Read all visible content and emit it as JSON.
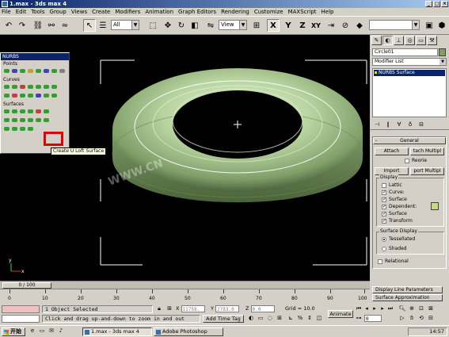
{
  "window": {
    "title": "1.max - 3ds max 4"
  },
  "menu": [
    "File",
    "Edit",
    "Tools",
    "Group",
    "Views",
    "Create",
    "Modifiers",
    "Animation",
    "Graph Editors",
    "Rendering",
    "Customize",
    "MAXScript",
    "Help"
  ],
  "toolbar": {
    "selection_filter": "All",
    "reference_coord": "View",
    "axis_x": "X",
    "axis_y": "Y",
    "axis_z": "Z",
    "axis_xy": "XY"
  },
  "nurbs_panel": {
    "title": "NURBS",
    "section_points": "Points",
    "section_curves": "Curves",
    "section_surfaces": "Surfaces",
    "tooltip": "Create U Loft Surface"
  },
  "viewport": {
    "watermark": "WWW.CN",
    "axis_x": "x",
    "axis_y": "y"
  },
  "command_panel": {
    "object_name": "Circle01",
    "modifier_list": "Modifier List",
    "stack_item": "NURBS Surface",
    "general": {
      "title": "General",
      "attach": "Attach",
      "attach_multiple": "tach Multipl",
      "reorient": "Reorie",
      "import": "Import",
      "import_multiple": "port Multipl"
    },
    "display": {
      "title": "Display",
      "items": [
        {
          "label": "Lattic",
          "checked": false
        },
        {
          "label": "Curve:",
          "checked": true
        },
        {
          "label": "Surface",
          "checked": true
        },
        {
          "label": "Dependent:",
          "checked": true
        },
        {
          "label": "Surface",
          "checked": true
        },
        {
          "label": "Transform",
          "checked": true
        }
      ]
    },
    "surface_display": {
      "title": "Surface Display",
      "tessellated": "Tessellated",
      "shaded": "Shaded"
    },
    "relational": "Relational",
    "rollout_display_line": "Display Line Parameters",
    "rollout_surface_approx": "Surface Approximation"
  },
  "timeline": {
    "slider": "0 / 100",
    "ticks": [
      "0",
      "10",
      "20",
      "30",
      "40",
      "50",
      "60",
      "70",
      "80",
      "90",
      "100"
    ]
  },
  "status": {
    "selection": "1 Object Selected",
    "prompt": "Click and drag up-and-down to zoom in and out",
    "x_label": "X",
    "x_value": "11758.",
    "y_label": "Y",
    "y_value": "2783.0",
    "z_label": "Z",
    "z_value": "0.0",
    "grid": "Grid = 10.0",
    "add_time_tag": "Add Time Tag",
    "animate": "Animate",
    "frame": "0"
  },
  "taskbar": {
    "start": "开始",
    "tasks": [
      "1.max - 3ds max 4",
      "Adobe Photoshop"
    ],
    "clock": "14:57"
  },
  "colors": {
    "torus": "#b8d4a0",
    "highlight": "#e00000",
    "titlebar": "#0a246a"
  }
}
